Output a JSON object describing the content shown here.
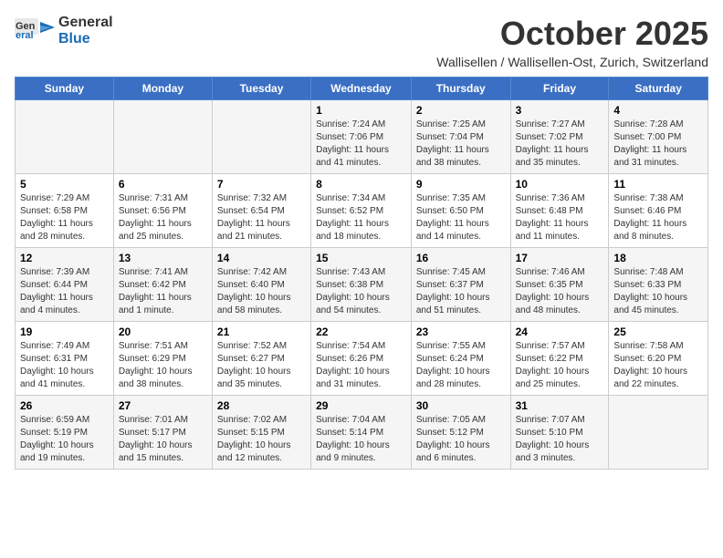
{
  "header": {
    "logo_general": "General",
    "logo_blue": "Blue",
    "month": "October 2025",
    "location": "Wallisellen / Wallisellen-Ost, Zurich, Switzerland"
  },
  "days_of_week": [
    "Sunday",
    "Monday",
    "Tuesday",
    "Wednesday",
    "Thursday",
    "Friday",
    "Saturday"
  ],
  "weeks": [
    [
      {
        "day": "",
        "info": ""
      },
      {
        "day": "",
        "info": ""
      },
      {
        "day": "",
        "info": ""
      },
      {
        "day": "1",
        "info": "Sunrise: 7:24 AM\nSunset: 7:06 PM\nDaylight: 11 hours and 41 minutes."
      },
      {
        "day": "2",
        "info": "Sunrise: 7:25 AM\nSunset: 7:04 PM\nDaylight: 11 hours and 38 minutes."
      },
      {
        "day": "3",
        "info": "Sunrise: 7:27 AM\nSunset: 7:02 PM\nDaylight: 11 hours and 35 minutes."
      },
      {
        "day": "4",
        "info": "Sunrise: 7:28 AM\nSunset: 7:00 PM\nDaylight: 11 hours and 31 minutes."
      }
    ],
    [
      {
        "day": "5",
        "info": "Sunrise: 7:29 AM\nSunset: 6:58 PM\nDaylight: 11 hours and 28 minutes."
      },
      {
        "day": "6",
        "info": "Sunrise: 7:31 AM\nSunset: 6:56 PM\nDaylight: 11 hours and 25 minutes."
      },
      {
        "day": "7",
        "info": "Sunrise: 7:32 AM\nSunset: 6:54 PM\nDaylight: 11 hours and 21 minutes."
      },
      {
        "day": "8",
        "info": "Sunrise: 7:34 AM\nSunset: 6:52 PM\nDaylight: 11 hours and 18 minutes."
      },
      {
        "day": "9",
        "info": "Sunrise: 7:35 AM\nSunset: 6:50 PM\nDaylight: 11 hours and 14 minutes."
      },
      {
        "day": "10",
        "info": "Sunrise: 7:36 AM\nSunset: 6:48 PM\nDaylight: 11 hours and 11 minutes."
      },
      {
        "day": "11",
        "info": "Sunrise: 7:38 AM\nSunset: 6:46 PM\nDaylight: 11 hours and 8 minutes."
      }
    ],
    [
      {
        "day": "12",
        "info": "Sunrise: 7:39 AM\nSunset: 6:44 PM\nDaylight: 11 hours and 4 minutes."
      },
      {
        "day": "13",
        "info": "Sunrise: 7:41 AM\nSunset: 6:42 PM\nDaylight: 11 hours and 1 minute."
      },
      {
        "day": "14",
        "info": "Sunrise: 7:42 AM\nSunset: 6:40 PM\nDaylight: 10 hours and 58 minutes."
      },
      {
        "day": "15",
        "info": "Sunrise: 7:43 AM\nSunset: 6:38 PM\nDaylight: 10 hours and 54 minutes."
      },
      {
        "day": "16",
        "info": "Sunrise: 7:45 AM\nSunset: 6:37 PM\nDaylight: 10 hours and 51 minutes."
      },
      {
        "day": "17",
        "info": "Sunrise: 7:46 AM\nSunset: 6:35 PM\nDaylight: 10 hours and 48 minutes."
      },
      {
        "day": "18",
        "info": "Sunrise: 7:48 AM\nSunset: 6:33 PM\nDaylight: 10 hours and 45 minutes."
      }
    ],
    [
      {
        "day": "19",
        "info": "Sunrise: 7:49 AM\nSunset: 6:31 PM\nDaylight: 10 hours and 41 minutes."
      },
      {
        "day": "20",
        "info": "Sunrise: 7:51 AM\nSunset: 6:29 PM\nDaylight: 10 hours and 38 minutes."
      },
      {
        "day": "21",
        "info": "Sunrise: 7:52 AM\nSunset: 6:27 PM\nDaylight: 10 hours and 35 minutes."
      },
      {
        "day": "22",
        "info": "Sunrise: 7:54 AM\nSunset: 6:26 PM\nDaylight: 10 hours and 31 minutes."
      },
      {
        "day": "23",
        "info": "Sunrise: 7:55 AM\nSunset: 6:24 PM\nDaylight: 10 hours and 28 minutes."
      },
      {
        "day": "24",
        "info": "Sunrise: 7:57 AM\nSunset: 6:22 PM\nDaylight: 10 hours and 25 minutes."
      },
      {
        "day": "25",
        "info": "Sunrise: 7:58 AM\nSunset: 6:20 PM\nDaylight: 10 hours and 22 minutes."
      }
    ],
    [
      {
        "day": "26",
        "info": "Sunrise: 6:59 AM\nSunset: 5:19 PM\nDaylight: 10 hours and 19 minutes."
      },
      {
        "day": "27",
        "info": "Sunrise: 7:01 AM\nSunset: 5:17 PM\nDaylight: 10 hours and 15 minutes."
      },
      {
        "day": "28",
        "info": "Sunrise: 7:02 AM\nSunset: 5:15 PM\nDaylight: 10 hours and 12 minutes."
      },
      {
        "day": "29",
        "info": "Sunrise: 7:04 AM\nSunset: 5:14 PM\nDaylight: 10 hours and 9 minutes."
      },
      {
        "day": "30",
        "info": "Sunrise: 7:05 AM\nSunset: 5:12 PM\nDaylight: 10 hours and 6 minutes."
      },
      {
        "day": "31",
        "info": "Sunrise: 7:07 AM\nSunset: 5:10 PM\nDaylight: 10 hours and 3 minutes."
      },
      {
        "day": "",
        "info": ""
      }
    ]
  ]
}
